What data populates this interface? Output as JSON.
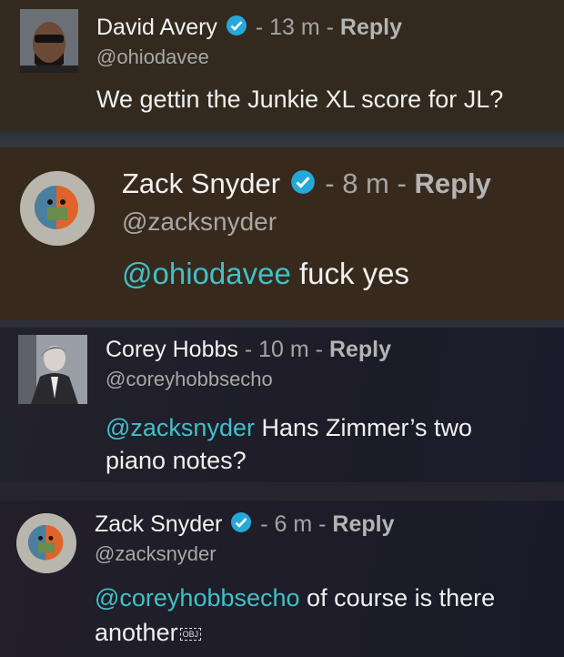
{
  "comments": [
    {
      "name": "David Avery",
      "time": "- 13 m -",
      "reply": "Reply",
      "handle": "@ohiodavee",
      "mention": "",
      "text": "We gettin the Junkie XL score for JL?"
    },
    {
      "name": "Zack Snyder",
      "time": "- 8 m -",
      "reply": "Reply",
      "handle": "@zacksnyder",
      "mention": "@ohiodavee",
      "text": " fuck yes"
    },
    {
      "name": "Corey Hobbs",
      "time": "- 10 m -",
      "reply": "Reply",
      "handle": "@coreyhobbsecho",
      "mention": "@zacksnyder",
      "text": " Hans Zimmer’s two",
      "text2": "piano notes?"
    },
    {
      "name": "Zack Snyder",
      "time": "- 6 m -",
      "reply": "Reply",
      "handle": "@zacksnyder",
      "mention": "@coreyhobbsecho",
      "text": " of course is there",
      "text2": "another",
      "obj": "OBJ"
    }
  ],
  "colors": {
    "mention": "#3fc1c9",
    "verified": "#26a8d8"
  },
  "icons": {
    "verified": "verified-check-icon"
  }
}
